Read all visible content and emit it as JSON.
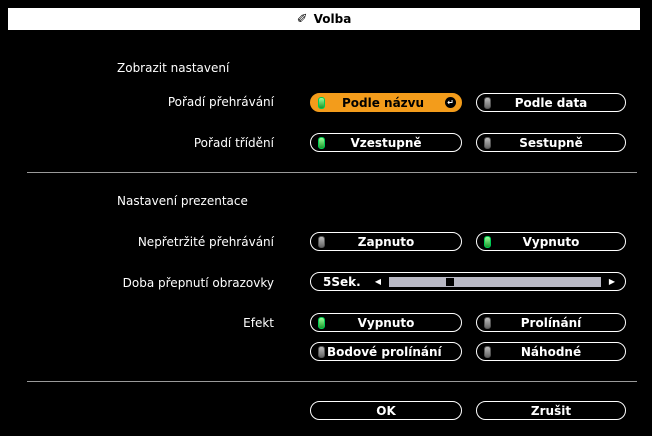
{
  "title": {
    "icon": "tools-icon",
    "text": "Volba"
  },
  "display_section": {
    "heading": "Zobrazit nastavení",
    "play_order": {
      "label": "Pořadí přehrávání",
      "options": [
        {
          "label": "Podle názvu",
          "selected": true,
          "active": true
        },
        {
          "label": "Podle data",
          "selected": false,
          "active": false
        }
      ]
    },
    "sort_order": {
      "label": "Pořadí třídění",
      "options": [
        {
          "label": "Vzestupně",
          "selected": false,
          "active": true
        },
        {
          "label": "Sestupně",
          "selected": false,
          "active": false
        }
      ]
    }
  },
  "slideshow_section": {
    "heading": "Nastavení prezentace",
    "continuous_play": {
      "label": "Nepřetržité přehrávání",
      "options": [
        {
          "label": "Zapnuto",
          "active": false
        },
        {
          "label": "Vypnuto",
          "active": true
        }
      ]
    },
    "screen_switch_time": {
      "label": "Doba přepnutí obrazovky",
      "value": "5",
      "unit": "Sek.",
      "slider_fraction": 0.27
    },
    "effect": {
      "label": "Efekt",
      "options": [
        {
          "label": "Vypnuto",
          "active": true
        },
        {
          "label": "Prolínání",
          "active": false
        },
        {
          "label": "Bodové prolínání",
          "active": false
        },
        {
          "label": "Náhodné",
          "active": false
        }
      ]
    }
  },
  "footer": {
    "ok_label": "OK",
    "cancel_label": "Zrušit"
  },
  "colors": {
    "selected": "#f39c1b",
    "led_on": "#1c9a2c",
    "slider_track": "#b8b8c4"
  }
}
